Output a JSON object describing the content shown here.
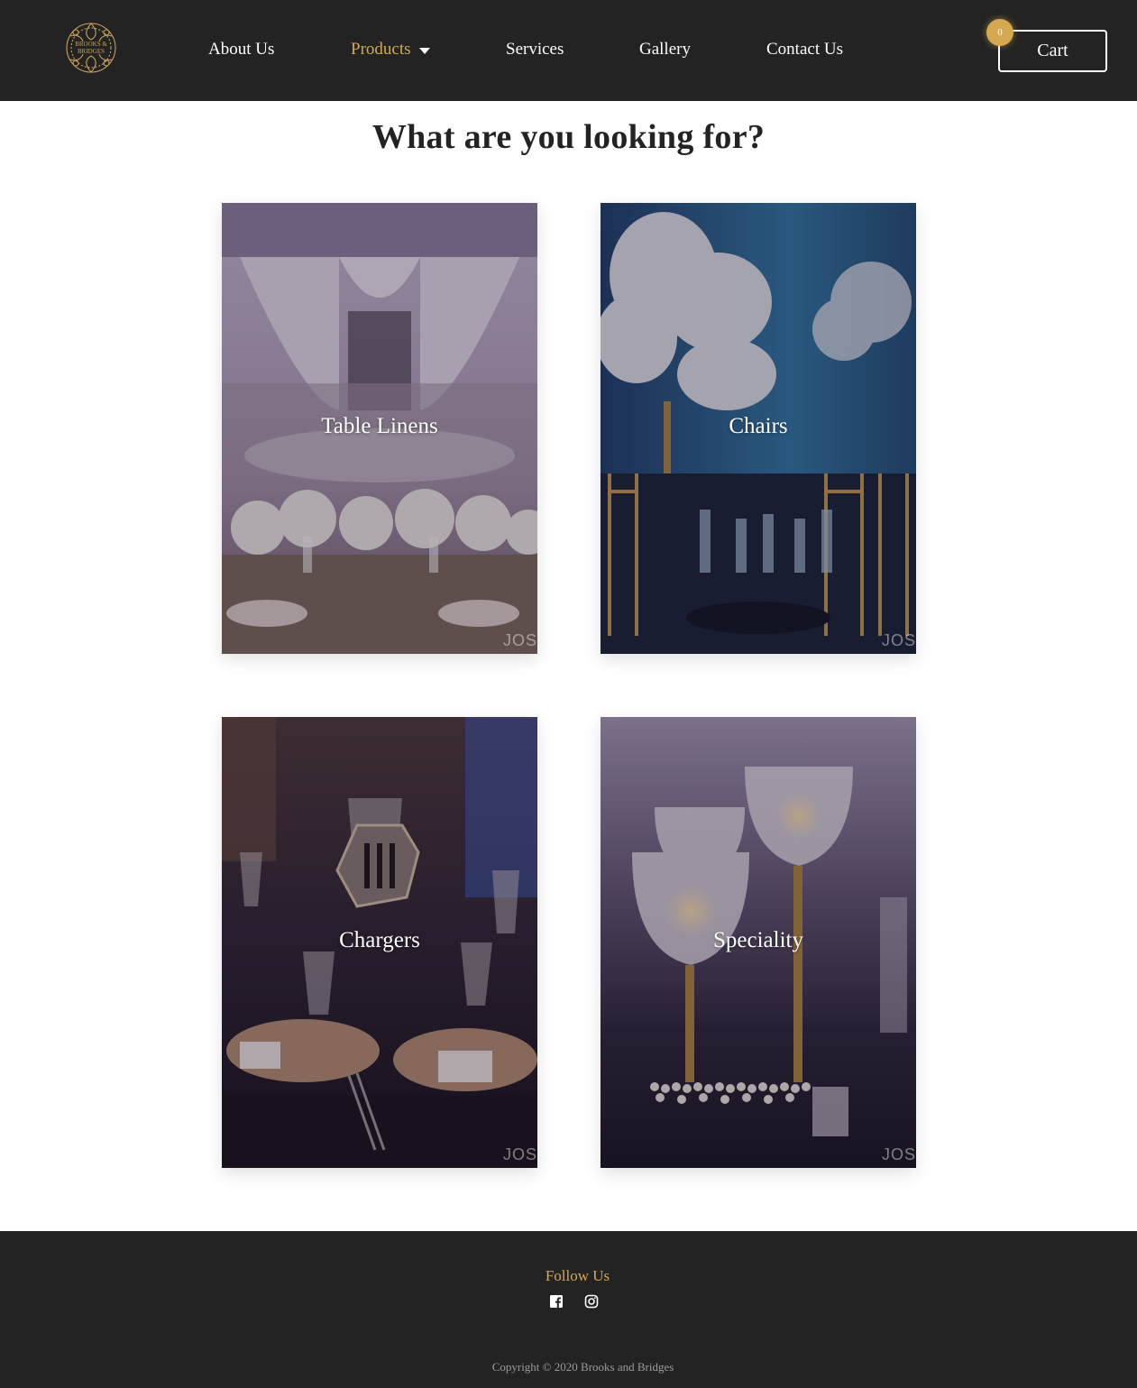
{
  "header": {
    "logo_text_line1": "BROOKS &",
    "logo_text_line2": "BRIDGES",
    "nav": {
      "about": "About Us",
      "products": "Products",
      "services": "Services",
      "gallery": "Gallery",
      "contact": "Contact Us"
    },
    "cart_label": "Cart",
    "cart_count": "0"
  },
  "main": {
    "heading": "What are you looking for?",
    "cards": [
      {
        "label": "Table Linens",
        "watermark": "JOS"
      },
      {
        "label": "Chairs",
        "watermark": "JOS"
      },
      {
        "label": "Chargers",
        "watermark": "JOS"
      },
      {
        "label": "Speciality",
        "watermark": "JOS"
      }
    ]
  },
  "footer": {
    "follow_label": "Follow Us",
    "copyright": "Copyright © 2020 Brooks and Bridges"
  },
  "colors": {
    "header_bg": "#232323",
    "accent_gold": "#d4a94f",
    "text_dark": "#232323"
  },
  "icons": [
    "logo-emblem",
    "chevron-down-icon",
    "facebook-icon",
    "instagram-icon"
  ]
}
